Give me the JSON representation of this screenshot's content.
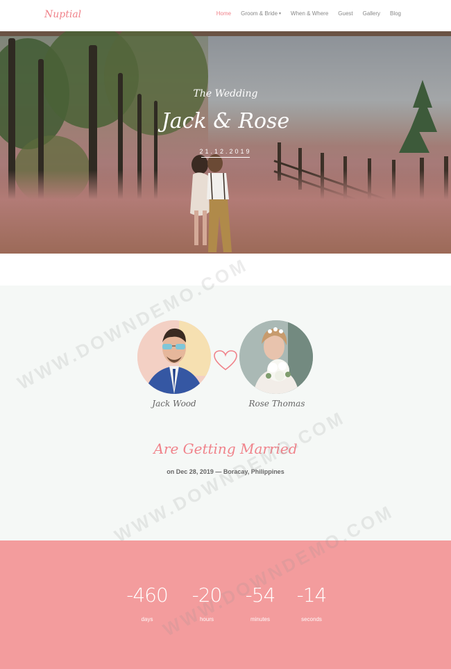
{
  "nav": {
    "logo": "Nuptial",
    "items": [
      {
        "label": "Home",
        "active": true,
        "dropdown": false
      },
      {
        "label": "Groom & Bride",
        "active": false,
        "dropdown": true
      },
      {
        "label": "When & Where",
        "active": false,
        "dropdown": false
      },
      {
        "label": "Guest",
        "active": false,
        "dropdown": false
      },
      {
        "label": "Gallery",
        "active": false,
        "dropdown": false
      },
      {
        "label": "Blog",
        "active": false,
        "dropdown": false
      }
    ],
    "caret": "▾"
  },
  "hero": {
    "subtitle": "The Wedding",
    "title": "Jack & Rose",
    "date": "21.12.2019"
  },
  "couple": {
    "groom_name": "Jack Wood",
    "bride_name": "Rose Thomas",
    "headline": "Are Getting Married",
    "details": "on Dec 28, 2019 — Boracay, Philippines"
  },
  "countdown": {
    "items": [
      {
        "value": "-460",
        "label": "days"
      },
      {
        "value": "-20",
        "label": "hours"
      },
      {
        "value": "-54",
        "label": "minutes"
      },
      {
        "value": "-14",
        "label": "seconds"
      }
    ]
  },
  "watermark": "WWW.DOWNDEMO.COM",
  "colors": {
    "accent": "#f0828a",
    "countdown_bg": "#f39c9d",
    "section_bg": "#f5f8f6"
  }
}
